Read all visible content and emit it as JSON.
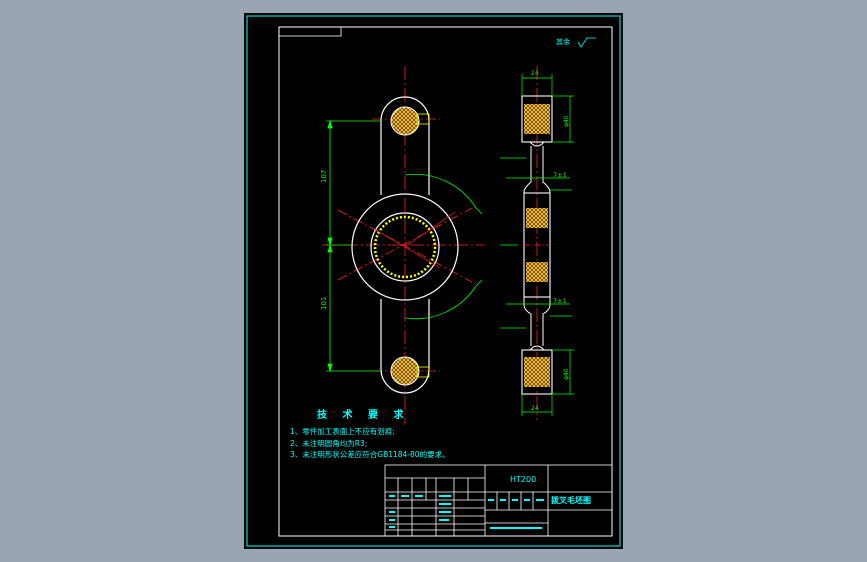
{
  "colors": {
    "background": "#9aa5b3",
    "sheet": "#000000",
    "border": "#00ffff",
    "frame": "#ffffff",
    "centerline": "#ff2020",
    "dimension": "#00ff00",
    "annotation": "#00ffff",
    "hatch": "#ffff00",
    "section_fill": "#803030",
    "small_dim_text": "#ffff66"
  },
  "roughness_note": {
    "label": "其余",
    "symbol": "roughness-symbol"
  },
  "tech_requirements": {
    "title": "技 术 要 求",
    "items": [
      "1、零件加工表面上不应有划痕;",
      "2、未注明圆角均为R3;",
      "3、未注明形状公差应符合GB1184-80的要求。"
    ]
  },
  "dimensions": {
    "front_upper": "107",
    "front_lower": "101",
    "side_top_width": "24",
    "side_top_dia": "φ40",
    "side_mid_upper": "7±1",
    "side_mid_lower": "7±1",
    "side_bottom_dia": "φ40",
    "side_bottom_width": "24"
  },
  "title_block": {
    "material": "HT200",
    "part_name": "拨叉毛坯图"
  }
}
